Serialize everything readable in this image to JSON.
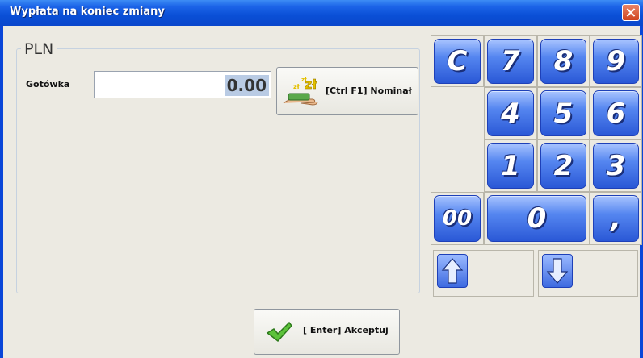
{
  "window": {
    "title": "Wypłata na koniec zmiany"
  },
  "currency": {
    "label": "PLN"
  },
  "cash": {
    "label": "Gotówka",
    "value": "0.00"
  },
  "nominal_button": {
    "label": "[Ctrl F1] Nominał",
    "icon_text": "zł"
  },
  "accept_button": {
    "label": "[ Enter] Akceptuj"
  },
  "numpad": {
    "clear": "C",
    "k7": "7",
    "k8": "8",
    "k9": "9",
    "k4": "4",
    "k5": "5",
    "k6": "6",
    "k1": "1",
    "k2": "2",
    "k3": "3",
    "k00": "00",
    "k0": "0",
    "comma": ","
  },
  "icons": {
    "up": "arrow-up-icon",
    "down": "arrow-down-icon",
    "accept": "checkmark-icon",
    "money": "money-hand-icon",
    "close": "close-icon"
  }
}
